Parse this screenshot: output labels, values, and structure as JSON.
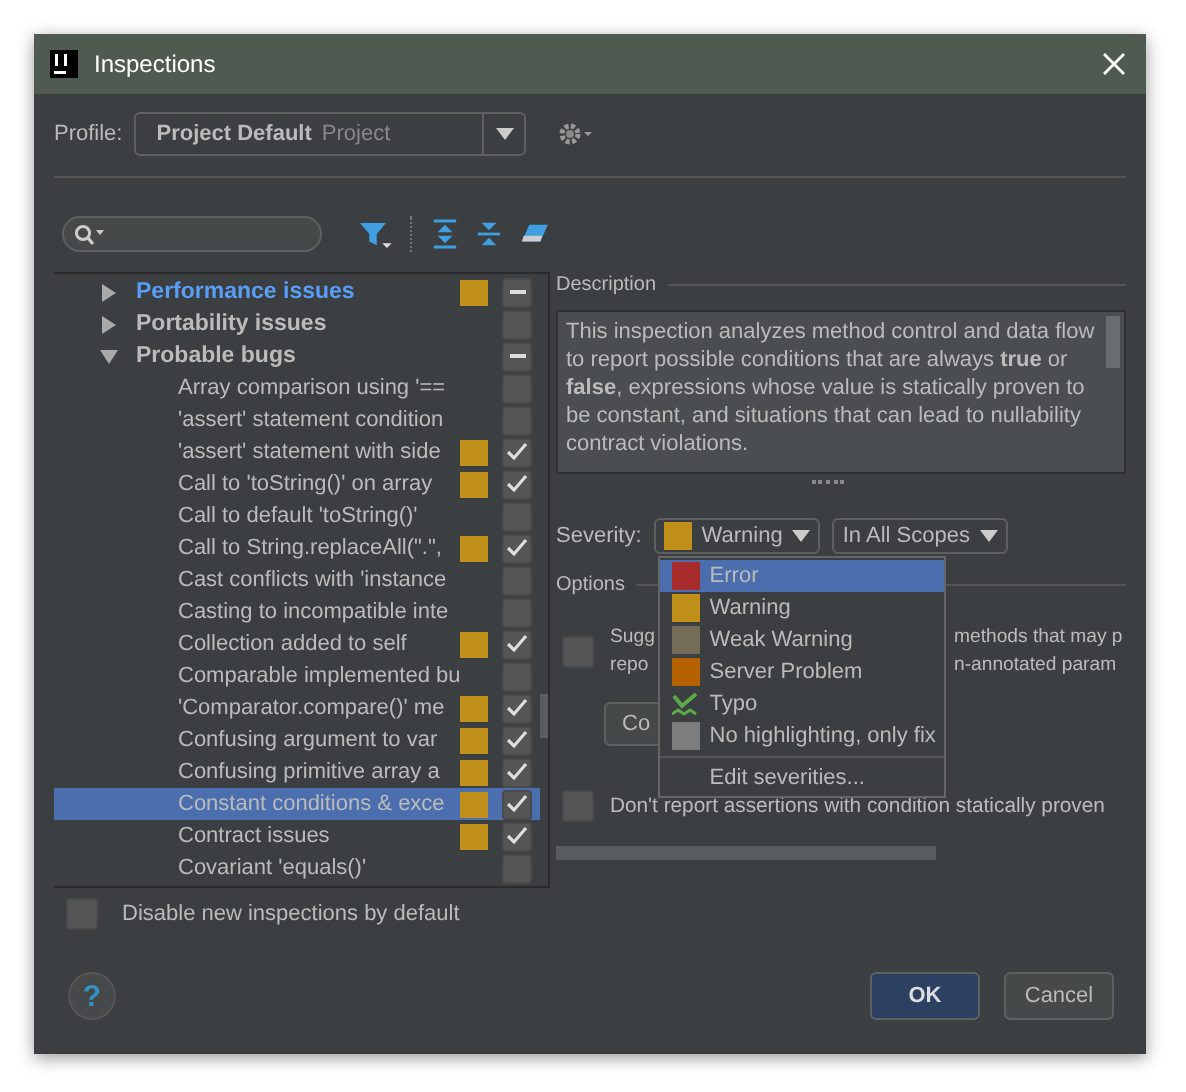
{
  "window": {
    "title": "Inspections"
  },
  "profile": {
    "label": "Profile:",
    "name": "Project Default",
    "scope": "Project"
  },
  "tree": [
    {
      "label": "Performance issues",
      "highlighted": true,
      "expanded": false,
      "color": "#c0901a",
      "mixed": true
    },
    {
      "label": "Portability issues",
      "highlighted": false,
      "expanded": false,
      "mixed": false
    },
    {
      "label": "Probable bugs",
      "highlighted": false,
      "expanded": true,
      "mixed": true,
      "children": [
        {
          "label": "Array comparison using '==",
          "selected": false,
          "checked": false
        },
        {
          "label": "'assert' statement condition",
          "selected": false,
          "checked": false
        },
        {
          "label": "'assert' statement with side",
          "selected": false,
          "checked": true,
          "color": "#c0901a"
        },
        {
          "label": "Call to 'toString()' on array",
          "selected": false,
          "checked": true,
          "color": "#c0901a"
        },
        {
          "label": "Call to default 'toString()'",
          "selected": false,
          "checked": false
        },
        {
          "label": "Call to String.replaceAll(\".\",",
          "selected": false,
          "checked": true,
          "color": "#c0901a"
        },
        {
          "label": "Cast conflicts with 'instance",
          "selected": false,
          "checked": false
        },
        {
          "label": "Casting to incompatible inte",
          "selected": false,
          "checked": false
        },
        {
          "label": "Collection added to self",
          "selected": false,
          "checked": true,
          "color": "#c0901a"
        },
        {
          "label": "Comparable implemented bu",
          "selected": false,
          "checked": false
        },
        {
          "label": "'Comparator.compare()' me",
          "selected": false,
          "checked": true,
          "color": "#c0901a"
        },
        {
          "label": "Confusing argument to var",
          "selected": false,
          "checked": true,
          "color": "#c0901a"
        },
        {
          "label": "Confusing primitive array a",
          "selected": false,
          "checked": true,
          "color": "#c0901a"
        },
        {
          "label": "Constant conditions & exce",
          "selected": true,
          "checked": true,
          "color": "#c0901a"
        },
        {
          "label": "Contract issues",
          "selected": false,
          "checked": true,
          "color": "#c0901a"
        },
        {
          "label": "Covariant 'equals()'",
          "selected": false,
          "checked": false
        }
      ]
    }
  ],
  "disable_new": {
    "label": "Disable new inspections by default",
    "checked": false
  },
  "description": {
    "title": "Description",
    "text": "This inspection analyzes method control and data flow to report possible conditions that are always **true** or **false**, expressions whose value is statically proven to be constant, and situations that can lead to nullability contract violations."
  },
  "severity": {
    "label": "Severity:",
    "value": "Warning",
    "color": "#c0901a",
    "scope": "In All Scopes"
  },
  "severity_menu": [
    {
      "kind": "swatch",
      "label": "Error",
      "color": "#a82b2b",
      "selected": true
    },
    {
      "kind": "swatch",
      "label": "Warning",
      "color": "#c0901a",
      "selected": false
    },
    {
      "kind": "swatch",
      "label": "Weak Warning",
      "color": "#756c58",
      "selected": false
    },
    {
      "kind": "swatch",
      "label": "Server Problem",
      "color": "#b66100",
      "selected": false
    },
    {
      "kind": "typo",
      "label": "Typo",
      "selected": false
    },
    {
      "kind": "swatch",
      "label": "No highlighting, only fix",
      "color": "#7d7d7d",
      "selected": false
    },
    {
      "kind": "action",
      "label": "Edit severities...",
      "selected": false
    }
  ],
  "options": {
    "title": "Options",
    "items": [
      {
        "checked": false,
        "lines": [
          [
            "Sugg",
            "methods that may p"
          ],
          [
            "repo",
            "n-annotated param"
          ]
        ]
      },
      {
        "checked": false,
        "lines": [
          [
            "Don't report assertions with condition statically proven"
          ]
        ]
      }
    ],
    "button": "Co"
  },
  "buttons": {
    "help": "?",
    "ok": "OK",
    "cancel": "Cancel"
  }
}
